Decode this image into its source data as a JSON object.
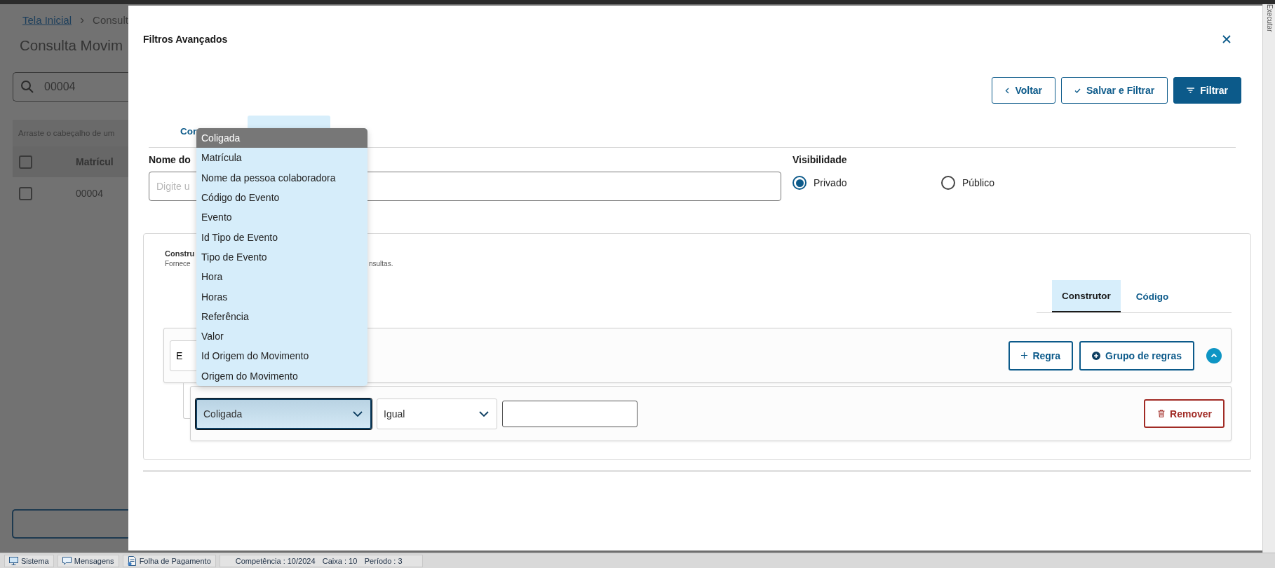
{
  "background_page": {
    "breadcrumb_separator": "›",
    "breadcrumb": [
      {
        "label": "Tela Inicial",
        "kind": "link"
      },
      {
        "label": "Consult",
        "kind": "current"
      }
    ],
    "title": "Consulta Movim",
    "search": {
      "value": "00004"
    },
    "group_hint": "Arraste o cabeçalho de um",
    "table": {
      "header_checked": false,
      "columns": [
        "Matrícul"
      ],
      "rows": [
        {
          "checked": false,
          "cells": [
            "00004"
          ]
        }
      ]
    }
  },
  "modal": {
    "title": "Filtros Avançados",
    "actions": [
      {
        "label": "Voltar",
        "kind": "back"
      },
      {
        "label": "Salvar e Filtrar",
        "kind": "save"
      },
      {
        "label": "Filtrar",
        "kind": "filter"
      }
    ],
    "tabs": [
      {
        "label": "Con",
        "selected": false
      },
      {
        "selected": true
      }
    ],
    "name_field": {
      "label": "Nome do",
      "placeholder": "Digite u"
    },
    "visibility": {
      "label": "Visibilidade",
      "options": [
        {
          "label": "Privado",
          "selected": true
        },
        {
          "label": "Público",
          "selected": false
        }
      ]
    },
    "builder": {
      "title": "Constru",
      "description_parts": [
        "Fornece",
        "nsultas."
      ],
      "tabs": [
        {
          "label": "Construtor",
          "selected": true
        },
        {
          "label": "Código",
          "selected": false
        }
      ],
      "group": {
        "operator": "E",
        "expanded": true,
        "actions": [
          {
            "label": "Regra",
            "kind": "rule"
          },
          {
            "label": "Grupo de regras",
            "kind": "group"
          }
        ]
      },
      "rule": {
        "field": "Coligada",
        "operator": "Igual",
        "remove_label": "Remover"
      }
    },
    "dropdown": {
      "options": [
        {
          "label": "Coligada",
          "selected": true
        },
        {
          "label": "Matrícula",
          "selected": false
        },
        {
          "label": "Nome da pessoa colaboradora",
          "selected": false
        },
        {
          "label": "Código do Evento",
          "selected": false
        },
        {
          "label": "Evento",
          "selected": false
        },
        {
          "label": "Id Tipo de Evento",
          "selected": false
        },
        {
          "label": "Tipo de Evento",
          "selected": false
        },
        {
          "label": "Hora",
          "selected": false
        },
        {
          "label": "Horas",
          "selected": false
        },
        {
          "label": "Referência",
          "selected": false
        },
        {
          "label": "Valor",
          "selected": false
        },
        {
          "label": "Id Origem do Movimento",
          "selected": false
        },
        {
          "label": "Origem do Movimento",
          "selected": false
        }
      ]
    }
  },
  "side_tab": {
    "label": "Executar"
  },
  "status_bar": [
    {
      "label": "Sistema",
      "kind": "system"
    },
    {
      "label": "Mensagens",
      "kind": "messages"
    },
    {
      "label": "Folha de Pagamento",
      "kind": "module"
    },
    {
      "label": "Competência : 10/2024",
      "kind": "info"
    },
    {
      "label": "Caixa : 10",
      "kind": "info"
    },
    {
      "label": "Período : 3",
      "kind": "info"
    }
  ]
}
